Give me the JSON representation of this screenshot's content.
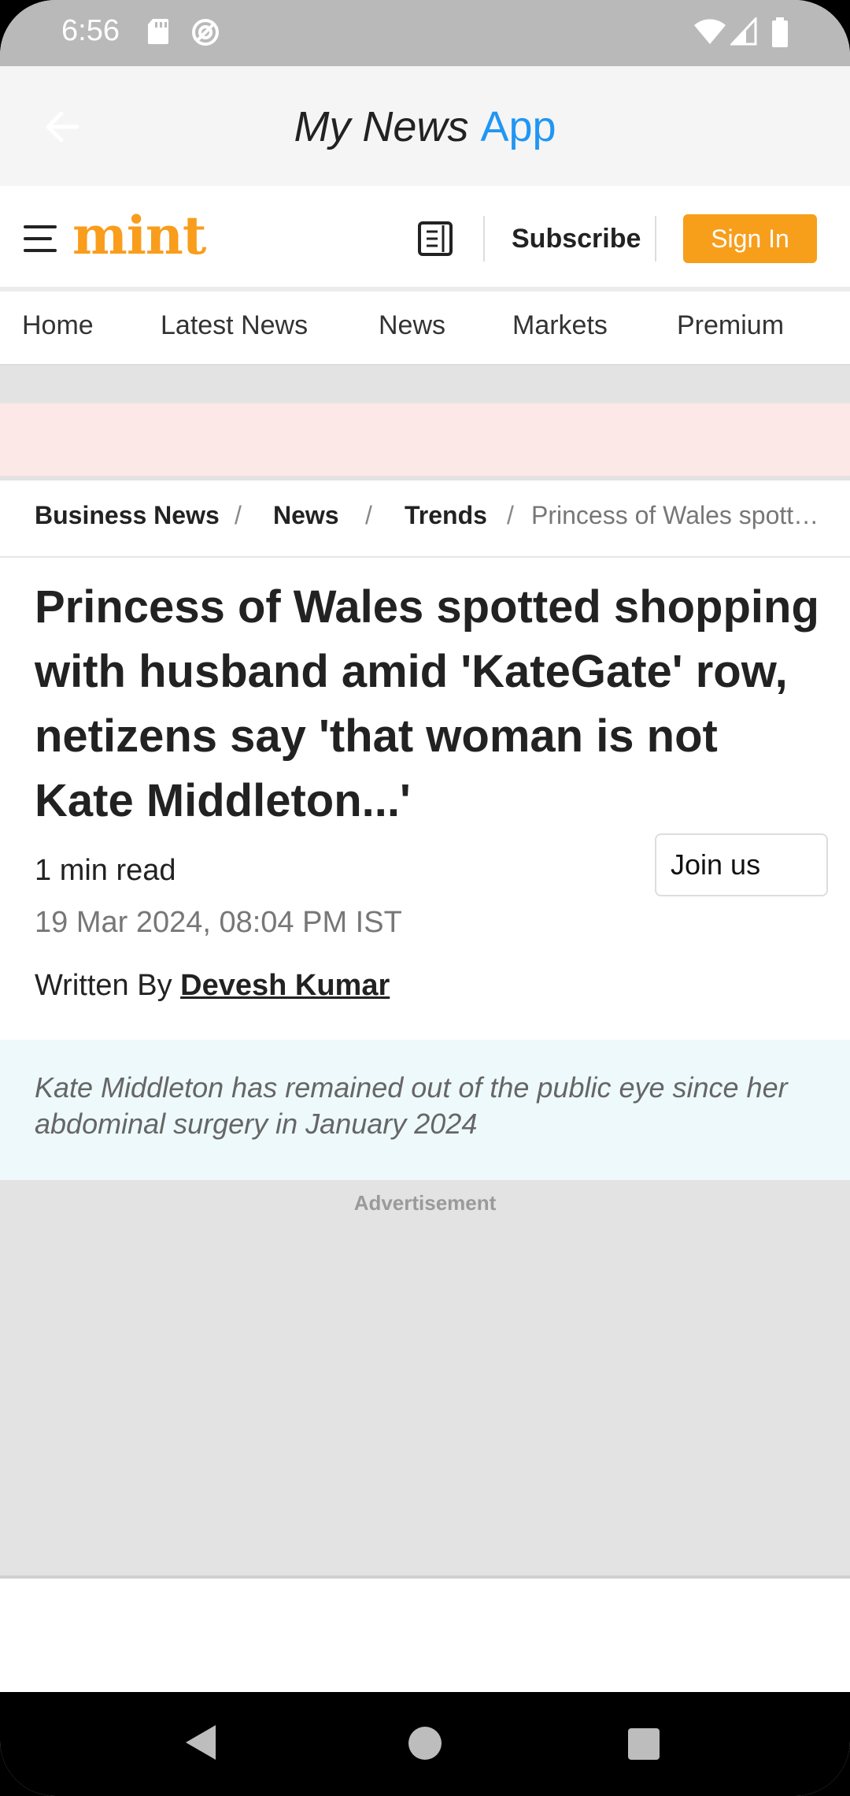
{
  "status_bar": {
    "time": "6:56",
    "icons": [
      "sd-card-icon",
      "data-saver-icon",
      "wifi-icon",
      "signal-icon",
      "battery-icon"
    ]
  },
  "app_bar": {
    "title_main": "My News",
    "title_accent": "App",
    "accent_color": "#2196f3"
  },
  "site_header": {
    "logo": "mint",
    "logo_color": "#f99d1c",
    "subscribe_label": "Subscribe",
    "signin_label": "Sign In",
    "signin_color": "#f79e1b"
  },
  "nav": {
    "items": [
      "Home",
      "Latest News",
      "News",
      "Markets",
      "Premium"
    ]
  },
  "breadcrumb": {
    "items": [
      "Business News",
      "News",
      "Trends"
    ],
    "separator": "/",
    "current": "Princess of Wales spotted shopping with husband amid 'KateGate' row, netizens say 'that woman is not Kate Middleton...'"
  },
  "article": {
    "headline": "Princess of Wales spotted shopping with husband amid 'KateGate' row, netizens say 'that woman is not Kate Middleton...'",
    "read_time": "1 min read",
    "date": "19 Mar 2024, 08:04 PM IST",
    "author_prefix": "Written By",
    "author_name": "Devesh Kumar",
    "join_label": "Join us",
    "summary": "Kate Middleton has remained out of the public eye since her abdominal surgery in January 2024"
  },
  "ad": {
    "label": "Advertisement"
  }
}
